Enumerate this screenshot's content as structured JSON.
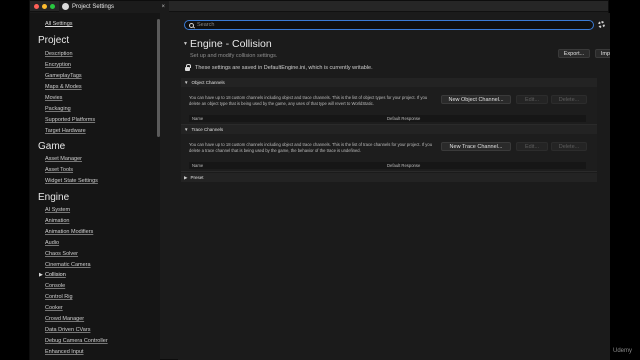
{
  "window": {
    "tab_title": "Project Settings",
    "tab_close": "×"
  },
  "sidebar": {
    "all_settings": "All Settings",
    "categories": [
      {
        "name": "Project",
        "items": [
          "Description",
          "Encryption",
          "GameplayTags",
          "Maps & Modes",
          "Movies",
          "Packaging",
          "Supported Platforms",
          "Target Hardware"
        ]
      },
      {
        "name": "Game",
        "items": [
          "Asset Manager",
          "Asset Tools",
          "Widget State Settings"
        ]
      },
      {
        "name": "Engine",
        "items": [
          "AI System",
          "Animation",
          "Animation Modifiers",
          "Audio",
          "Chaos Solver",
          "Cinematic Camera",
          "Collision",
          "Console",
          "Control Rig",
          "Cooker",
          "Crowd Manager",
          "Data Driven CVars",
          "Debug Camera Controller",
          "Enhanced Input"
        ]
      }
    ],
    "active_item": "Collision"
  },
  "search": {
    "placeholder": "Search",
    "value": ""
  },
  "header": {
    "title": "Engine - Collision",
    "subtitle": "Set up and modify collision settings.",
    "export_label": "Export...",
    "import_label": "Import...",
    "info": "These settings are saved in DefaultEngine.ini, which is currently writable."
  },
  "sections": {
    "object": {
      "title": "Object Channels",
      "desc": "You can have up to 18 custom channels including object and trace channels. This is the list of object types for your project. If you delete an object type that is being used by the game, any uses of that type will revert to WorldStatic.",
      "new_label": "New Object Channel...",
      "edit_label": "Edit...",
      "delete_label": "Delete...",
      "col_name": "Name",
      "col_response": "Default Response"
    },
    "trace": {
      "title": "Trace Channels",
      "desc": "You can have up to 18 custom channels including object and trace channels. This is the list of trace channels for your project. If you delete a trace channel that is being used by the game, the behavior of the trace is undefined.",
      "new_label": "New Trace Channel...",
      "edit_label": "Edit...",
      "delete_label": "Delete...",
      "col_name": "Name",
      "col_response": "Default Response"
    },
    "preset": {
      "title": "Preset"
    }
  },
  "watermark": "Udemy",
  "icons": [
    "search-icon",
    "gear-icon",
    "lock-icon",
    "caret-down-icon",
    "caret-right-icon",
    "app-icon",
    "close-icon"
  ]
}
